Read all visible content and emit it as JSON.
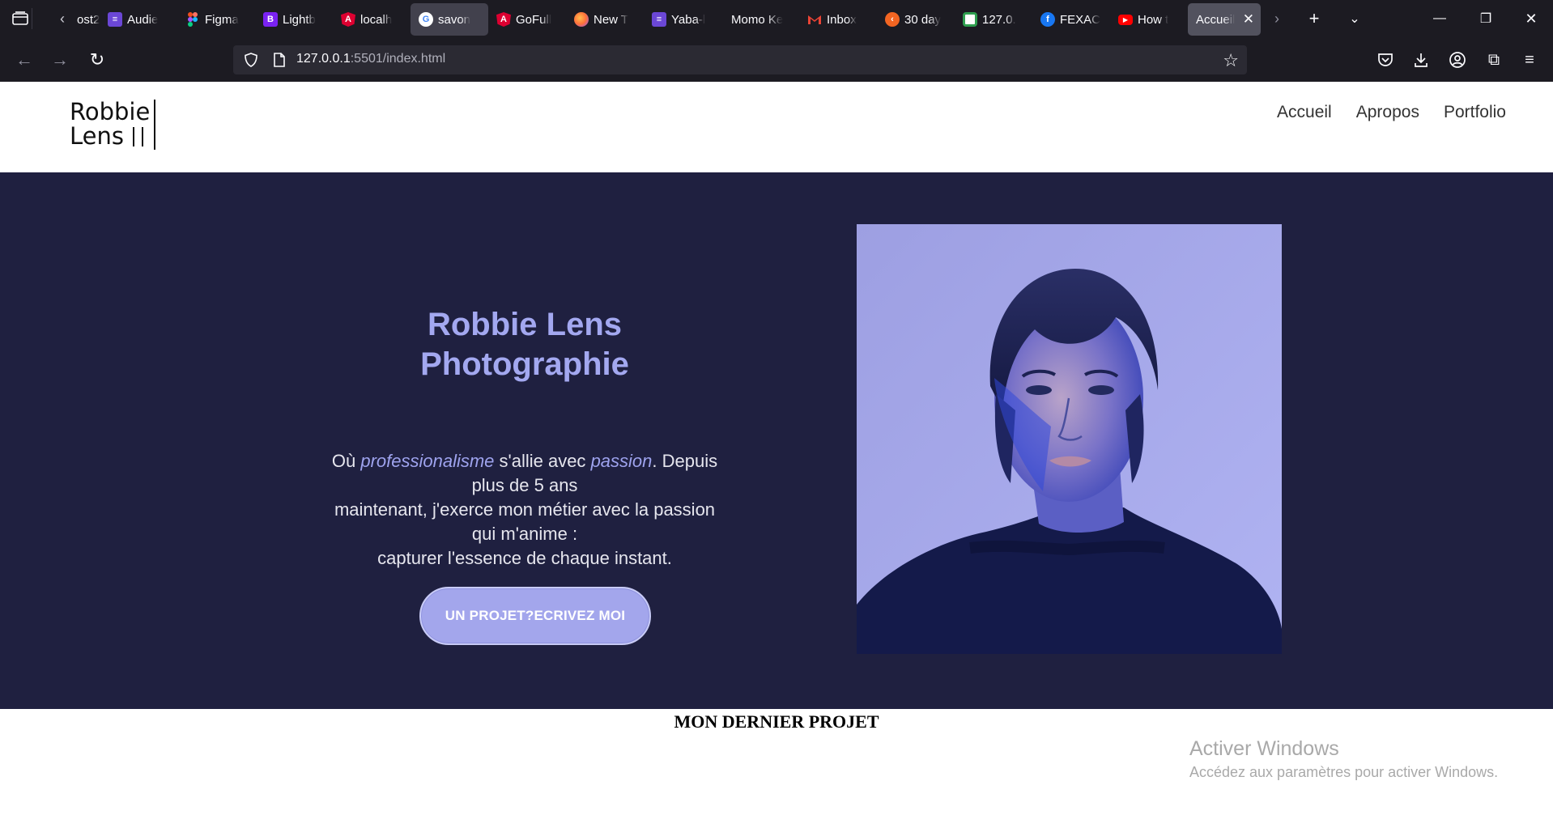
{
  "browser": {
    "tabs": [
      {
        "label": "ost2",
        "favicon": "blank",
        "color": ""
      },
      {
        "label": "Audie",
        "favicon": "list-icon",
        "color": "#6b47d6"
      },
      {
        "label": "Figma",
        "favicon": "figma-icon",
        "color": "#1e1e1e"
      },
      {
        "label": "Lightb",
        "favicon": "bootstrap-icon",
        "color": "#7a22f2"
      },
      {
        "label": "localh",
        "favicon": "angular-icon",
        "color": "#dd0031"
      },
      {
        "label": "savon",
        "favicon": "google-icon",
        "color": "#ffffff"
      },
      {
        "label": "GoFull",
        "favicon": "angular-icon",
        "color": "#dd0031"
      },
      {
        "label": "New T",
        "favicon": "firefox-icon",
        "color": "#ff7139"
      },
      {
        "label": "Yaba-l",
        "favicon": "list-icon",
        "color": "#6b47d6"
      },
      {
        "label": "Momo Ke",
        "favicon": "blank",
        "color": ""
      },
      {
        "label": "Inbox",
        "favicon": "gmail-icon",
        "color": "#ea4335"
      },
      {
        "label": "30 day",
        "favicon": "orange-icon",
        "color": "#f26522"
      },
      {
        "label": "127.0.",
        "favicon": "green-icon",
        "color": "#2e9e4f"
      },
      {
        "label": "FEXAC",
        "favicon": "facebook-icon",
        "color": "#1877f2"
      },
      {
        "label": "How t",
        "favicon": "youtube-icon",
        "color": "#ff0000"
      },
      {
        "label": "Accueil",
        "favicon": "blank",
        "color": ""
      }
    ],
    "url_host": "127.0.0.1",
    "url_rest": ":5501/index.html"
  },
  "site": {
    "logo_line1": "Robbie",
    "logo_line2": "Lens",
    "nav": {
      "home": "Accueil",
      "about": "Apropos",
      "portfolio": "Portfolio"
    },
    "hero": {
      "title_line1": "Robbie Lens",
      "title_line2": "Photographie",
      "text_p1": "Où ",
      "text_em1": "professionalisme",
      "text_p2": " s'allie avec ",
      "text_em2": "passion",
      "text_p3": ". Depuis plus de 5 ans",
      "text_line2": "maintenant, j'exerce mon métier avec la passion qui m'anime :",
      "text_line3": "capturer l'essence de chaque instant.",
      "cta": "UN PROJET?ECRIVEZ MOI"
    },
    "section_title": "MON DERNIER PROJET"
  },
  "overlay": {
    "activate_title": "Activer Windows",
    "activate_sub": "Accédez aux paramètres pour activer Windows."
  },
  "colors": {
    "hero_bg": "#1f2040",
    "accent": "#a3a8f0",
    "browser_bg": "#1c1b22"
  }
}
